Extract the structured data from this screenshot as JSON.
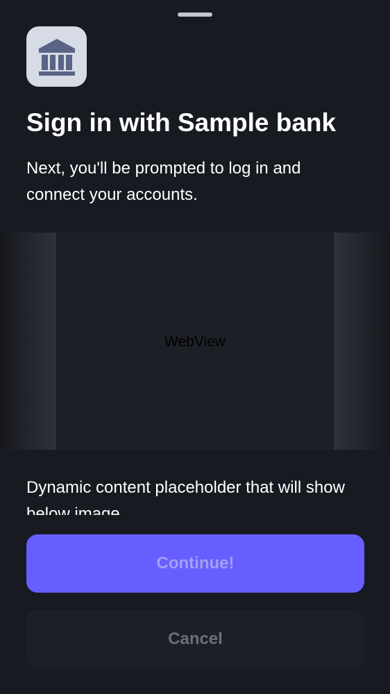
{
  "sheet": {
    "title": "Sign in with Sample bank",
    "subtitle": "Next, you'll be prompted to log in and connect your accounts.",
    "logo_icon": "bank-icon"
  },
  "webview": {
    "label": "WebView"
  },
  "dynamic_content": {
    "text": "Dynamic content placeholder that will show below image"
  },
  "buttons": {
    "continue_label": "Continue!",
    "cancel_label": "Cancel"
  },
  "colors": {
    "background": "#171a21",
    "primary_button": "#675eff",
    "secondary_button": "#1d1f26",
    "logo_tile": "#d6dbe5",
    "logo_glyph": "#5a6486"
  }
}
